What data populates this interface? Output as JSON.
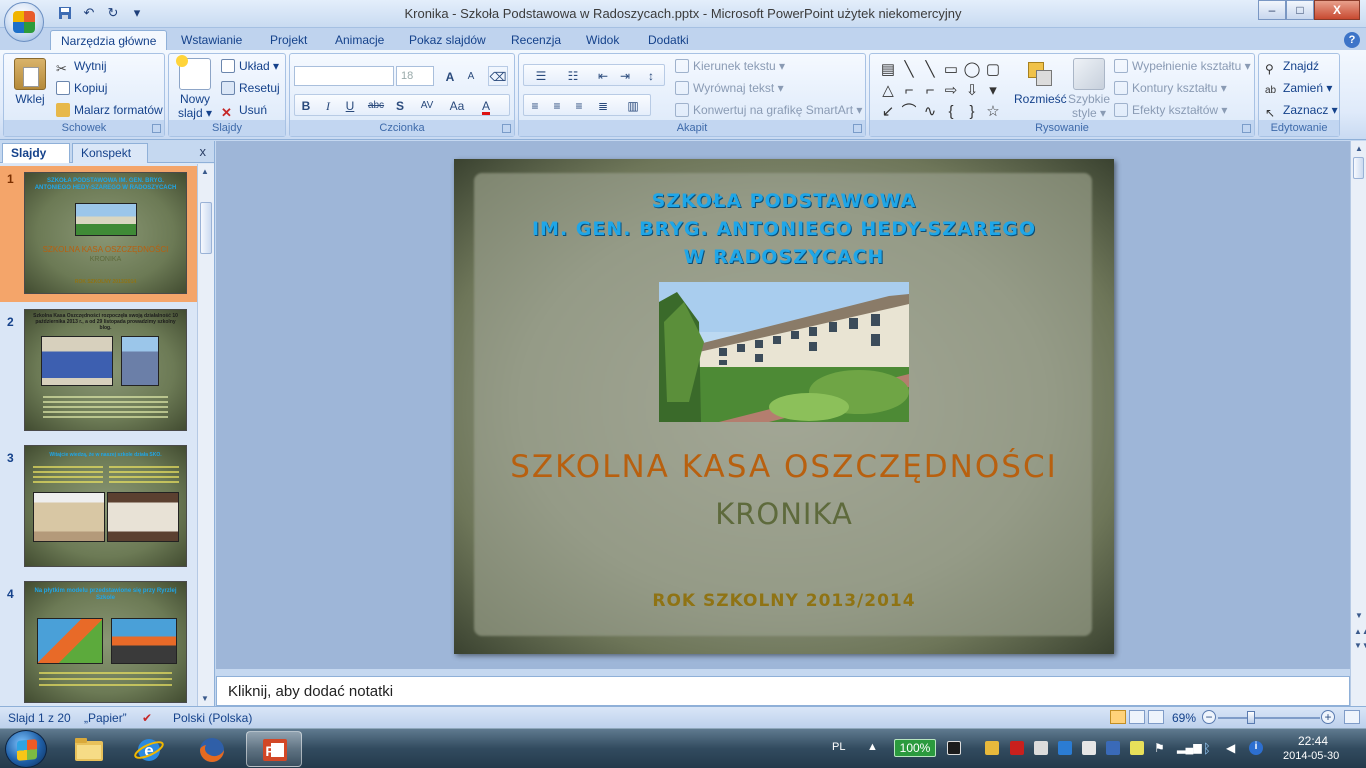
{
  "window": {
    "title": "Kronika - Szkoła Podstawowa w Radoszycach.pptx - Microsoft PowerPoint użytek niekomercyjny",
    "controls": {
      "minimize": "–",
      "maximize": "□",
      "close": "X"
    }
  },
  "quick_access": {
    "undo": "↶",
    "redo": "↻",
    "more": "▾"
  },
  "ribbon_tabs": [
    "Narzędzia główne",
    "Wstawianie",
    "Projekt",
    "Animacje",
    "Pokaz slajdów",
    "Recenzja",
    "Widok",
    "Dodatki"
  ],
  "help": "?",
  "ribbon": {
    "clipboard": {
      "label": "Schowek",
      "paste": "Wklej",
      "cut": "Wytnij",
      "copy": "Kopiuj",
      "format_painter": "Malarz formatów"
    },
    "slides": {
      "label": "Slajdy",
      "new_slide_line1": "Nowy",
      "new_slide_line2": "slajd ▾",
      "layout": "Układ ▾",
      "reset": "Resetuj",
      "delete": "Usuń"
    },
    "font": {
      "label": "Czcionka",
      "font_name": "",
      "font_size": "18",
      "bold": "B",
      "italic": "I",
      "underline": "U",
      "strike": "abc",
      "shadow": "S",
      "spacing": "AV",
      "case": "Aa",
      "color": "A",
      "grow": "A",
      "shrink": "A"
    },
    "paragraph": {
      "label": "Akapit",
      "text_direction": "Kierunek tekstu ▾",
      "align_text": "Wyrównaj tekst ▾",
      "smartart": "Konwertuj na grafikę SmartArt ▾"
    },
    "drawing": {
      "label": "Rysowanie",
      "arrange": "Rozmieść",
      "quick_styles_line1": "Szybkie",
      "quick_styles_line2": "style ▾",
      "fill": "Wypełnienie kształtu ▾",
      "outline": "Kontury kształtu ▾",
      "effects": "Efekty kształtów ▾",
      "shapes": [
        "▤",
        "╲",
        "╲",
        "▭",
        "◯",
        "▢",
        "△",
        "⌐",
        "⌐",
        "⇨",
        "⇩",
        "▾",
        "↙",
        "⌒",
        "∿",
        "{",
        "}",
        "☆"
      ]
    },
    "editing": {
      "label": "Edytowanie",
      "find": "Znajdź",
      "replace": "Zamień ▾",
      "select": "Zaznacz ▾"
    }
  },
  "left_pane": {
    "tabs": [
      "Slajdy",
      "Konspekt"
    ],
    "close": "x",
    "thumbnails": [
      {
        "num": "1",
        "title": "SZKOŁA PODSTAWOWA IM. GEN. BRYG. ANTONIEGO HEDY-SZAREGO W RADOSZYCACH",
        "heading": "SZKOLNA KASA OSZCZĘDNOŚCI",
        "sub": "KRONIKA",
        "foot": "ROK SZKOLNY 2013/2014"
      },
      {
        "num": "2",
        "title": "Szkolna Kasa Oszczędności rozpoczęła swoją działalność 10 października 2013 r., a od 29 listopada prowadzimy szkolny blog."
      },
      {
        "num": "3",
        "title": "Witajcie wiedzą, że w naszej szkole działa SKO."
      },
      {
        "num": "4",
        "title": "Na płytkim modelu przedstawione się przy Ryrzlej Szkole"
      }
    ]
  },
  "slide": {
    "school_line1": "SZKOŁA PODSTAWOWA",
    "school_line2": "IM. GEN. BRYG. ANTONIEGO HEDY-SZAREGO",
    "school_line3": "W RADOSZYCACH",
    "heading": "SZKOLNA KASA OSZCZĘDNOŚCI",
    "subheading": "KRONIKA",
    "year": "ROK SZKOLNY 2013/2014"
  },
  "notes": {
    "placeholder": "Kliknij, aby dodać notatki"
  },
  "status": {
    "slide_info": "Slajd 1 z 20",
    "theme": "„Papier”",
    "language": "Polski (Polska)",
    "zoom": "69%",
    "zoom_level": 0.69
  },
  "taskbar": {
    "lang": "PL",
    "battery": "100%",
    "time": "22:44",
    "date": "2014-05-30"
  },
  "colors": {
    "slide_title": "#1fa6e8",
    "slide_heading": "#b8600f",
    "slide_sub": "#5e6a3c",
    "slide_year": "#8f7314",
    "thumb_selected": "#f4a56a"
  }
}
